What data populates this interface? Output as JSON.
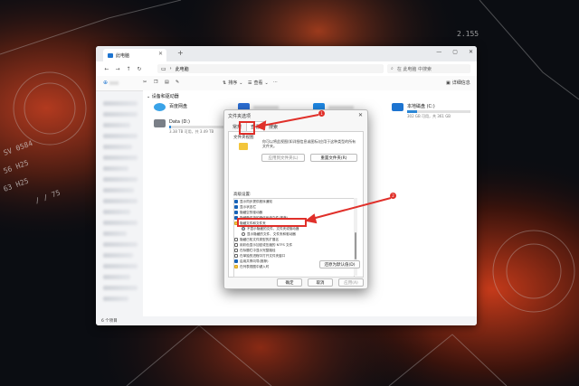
{
  "wallpaper": {
    "labels": [
      "2.155",
      "SV 0584",
      "56 H25",
      "63 H25",
      "/ / 75"
    ]
  },
  "explorer": {
    "tab_title": "此电脑",
    "address": "此电脑",
    "search_placeholder": "在 此电脑 中搜索",
    "commands": {
      "sort": "排序",
      "view": "查看",
      "details": "详细信息"
    },
    "section_header": "设备和驱动器",
    "drives": [
      {
        "name": "百度网盘",
        "sub": ""
      },
      {
        "name": "Data (D:)",
        "sub": "3.38 TB 可用，共 3.49 TB",
        "used_percent": 3
      },
      {
        "name": "本地磁盘 (C:)",
        "sub": "302 GB 可用，共 361 GB",
        "used_percent": 16
      }
    ],
    "status": "6 个项目"
  },
  "dialog": {
    "title": "文件夹选项",
    "tabs": [
      "常规",
      "查看",
      "搜索"
    ],
    "group_label": "文件夹视图",
    "view_text": "你可以将此视图(如详细信息或图标)应用于这种类型的所有文件夹。",
    "apply_button": "应用到文件夹(L)",
    "reset_button": "重置文件夹(R)",
    "advanced_label": "高级设置:",
    "options": [
      {
        "label": "显示同步提供程序通知",
        "type": "check",
        "on": true
      },
      {
        "label": "显示状态栏",
        "type": "check",
        "on": true
      },
      {
        "label": "隐藏空的驱动器",
        "type": "check",
        "on": true
      },
      {
        "label": "隐藏受保护的操作系统文件(推荐)",
        "type": "check",
        "on": true
      },
      {
        "label": "隐藏文件和文件夹",
        "type": "folder",
        "on": false
      },
      {
        "label": "不显示隐藏的文件、文件夹或驱动器",
        "type": "radio",
        "on": true
      },
      {
        "label": "显示隐藏的文件、文件夹和驱动器",
        "type": "radio",
        "on": false
      },
      {
        "label": "隐藏已知文件类型的扩展名",
        "type": "check",
        "on": false
      },
      {
        "label": "用彩色显示加密或压缩的 NTFS 文件",
        "type": "check",
        "on": false
      },
      {
        "label": "在标题栏中显示完整路径",
        "type": "check",
        "on": false
      },
      {
        "label": "在单独的进程中打开文件夹窗口",
        "type": "check",
        "on": false
      },
      {
        "label": "启用共享向导(推荐)",
        "type": "check",
        "on": true
      },
      {
        "label": "在列表视图中键入时",
        "type": "folder",
        "on": false
      }
    ],
    "restore_defaults": "还原为默认值(D)",
    "ok": "确定",
    "cancel": "取消",
    "apply": "应用(A)"
  },
  "annotations": {
    "badge1": "1",
    "badge2": "2"
  }
}
